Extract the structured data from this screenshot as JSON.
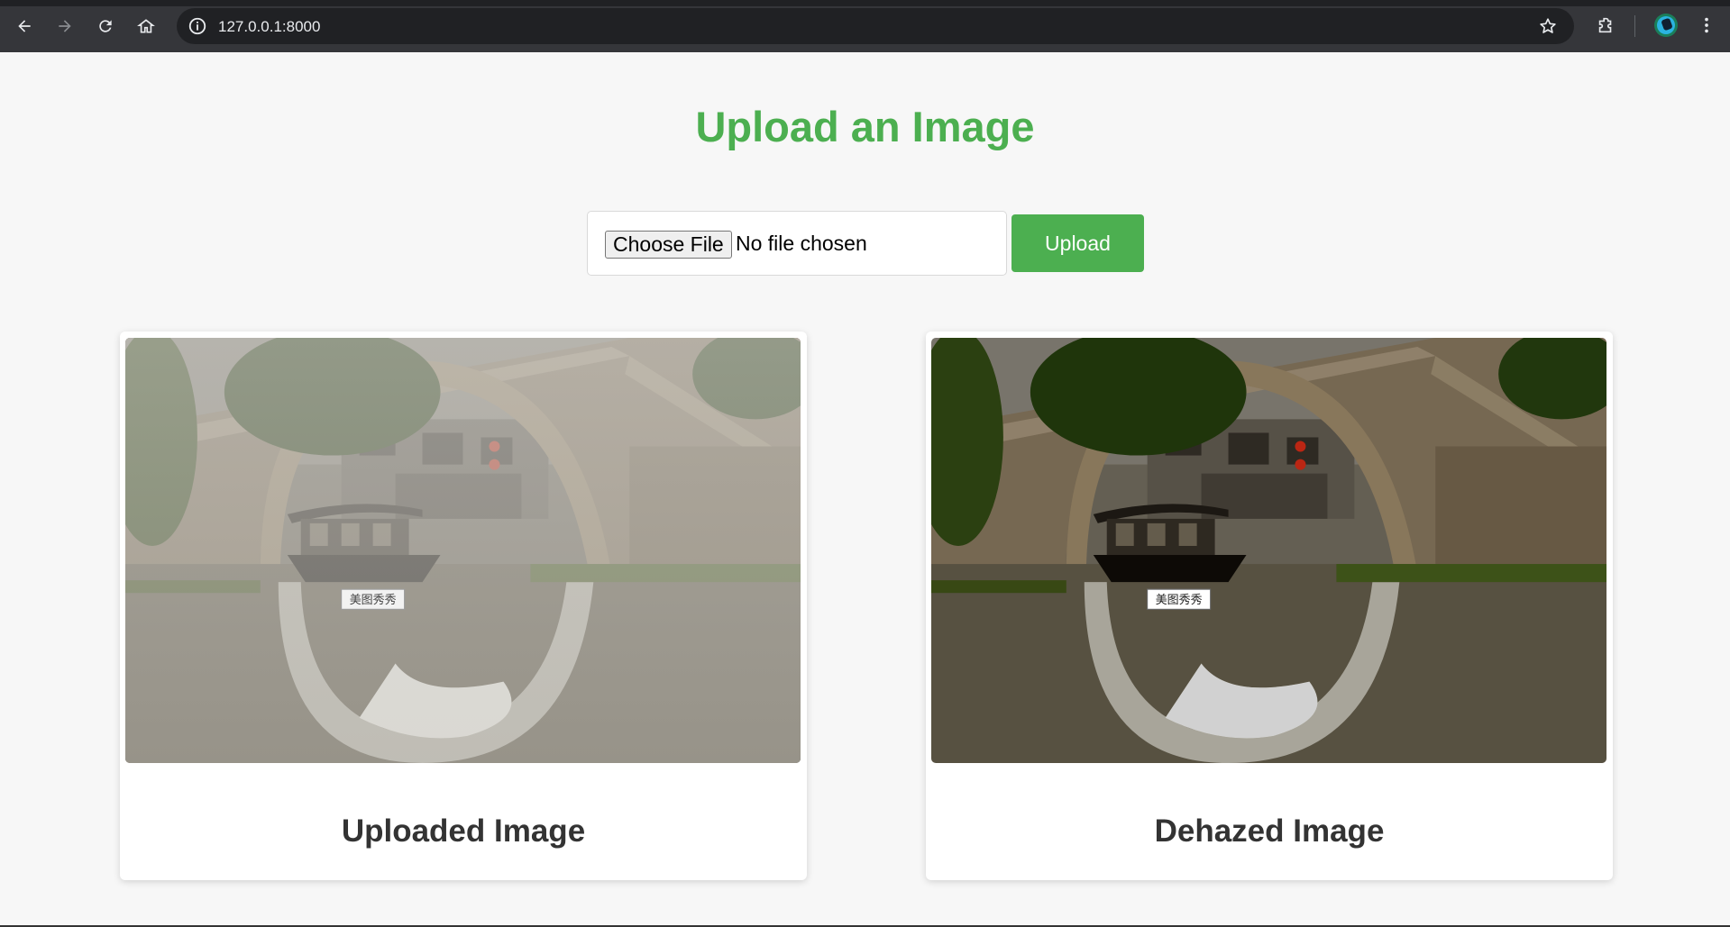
{
  "browser": {
    "url": "127.0.0.1:8000"
  },
  "page": {
    "title": "Upload an Image",
    "file_input": {
      "button_label": "Choose File",
      "status": "No file chosen"
    },
    "upload_button": "Upload",
    "cards": [
      {
        "caption": "Uploaded Image",
        "watermark": "美图秀秀",
        "style": "hazy"
      },
      {
        "caption": "Dehazed Image",
        "watermark": "美图秀秀",
        "style": "clear"
      }
    ]
  },
  "colors": {
    "accent": "#4caf50",
    "background": "#f7f7f7",
    "caption": "#333333"
  }
}
